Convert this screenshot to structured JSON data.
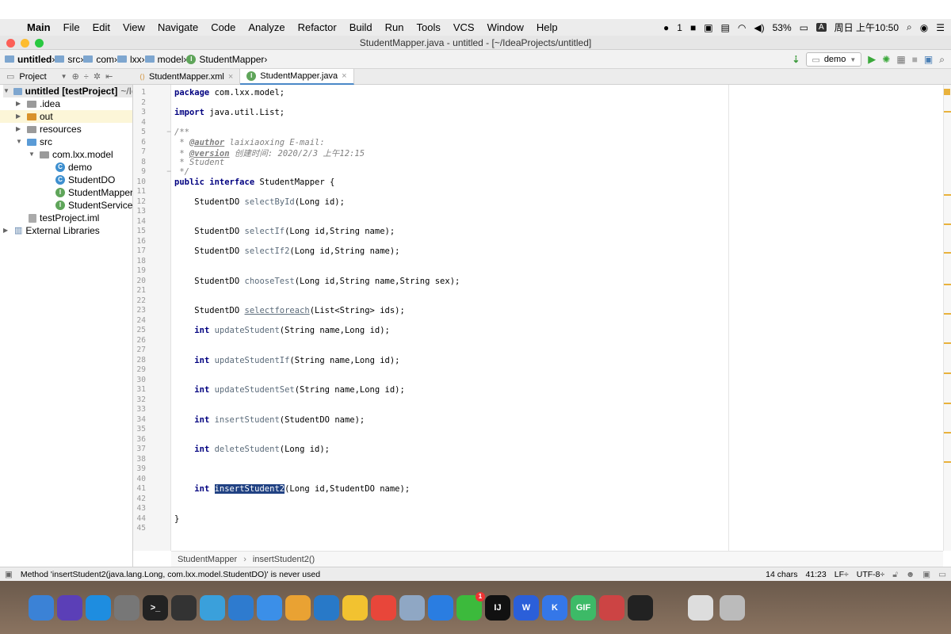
{
  "menubar": {
    "app": "Main",
    "items": [
      "File",
      "Edit",
      "View",
      "Navigate",
      "Code",
      "Analyze",
      "Refactor",
      "Build",
      "Run",
      "Tools",
      "VCS",
      "Window",
      "Help"
    ],
    "wechat_count": "1",
    "battery": "53%",
    "input_method": "A",
    "clock": "周日 上午10:50"
  },
  "window": {
    "title": "StudentMapper.java - untitled - [~/IdeaProjects/untitled]"
  },
  "navbar": {
    "crumbs": [
      "untitled",
      "src",
      "com",
      "lxx",
      "model",
      "StudentMapper"
    ],
    "run_config": "demo"
  },
  "toolwindow": {
    "label": "Project"
  },
  "tabs": [
    {
      "label": "StudentMapper.xml"
    },
    {
      "label": "StudentMapper.java"
    }
  ],
  "tree": [
    {
      "label": "untitled [testProject]",
      "suffix": "~/Ic"
    },
    {
      "label": ".idea"
    },
    {
      "label": "out"
    },
    {
      "label": "resources"
    },
    {
      "label": "src"
    },
    {
      "label": "com.lxx.model"
    },
    {
      "label": "demo"
    },
    {
      "label": "StudentDO"
    },
    {
      "label": "StudentMapper"
    },
    {
      "label": "StudentService"
    },
    {
      "label": "testProject.iml"
    },
    {
      "label": "External Libraries"
    }
  ],
  "code": {
    "line_numbers": [
      "1",
      "2",
      "3",
      "4",
      "5",
      "6",
      "7",
      "8",
      "9",
      "10",
      "11",
      "12",
      "13",
      "14",
      "15",
      "16",
      "17",
      "18",
      "19",
      "20",
      "21",
      "22",
      "23",
      "24",
      "25",
      "26",
      "27",
      "28",
      "29",
      "30",
      "31",
      "32",
      "33",
      "34",
      "35",
      "36",
      "37",
      "38",
      "39",
      "40",
      "41",
      "42",
      "43",
      "44",
      "45"
    ],
    "l1_kw": "package",
    "l1_rest": " com.lxx.model;",
    "l3_kw": "import",
    "l3_rest": " java.util.List;",
    "l5": "/**",
    "l6_pre": " * ",
    "l6_tag": "@author",
    "l6_rest": " laixiaoxing E-mail:",
    "l7_pre": " * ",
    "l7_tag": "@version",
    "l7_rest": " 创建时间: 2020/2/3 上午12:15",
    "l8": " * Student",
    "l9": " */",
    "l10_kw": "public interface",
    "l10_rest": " StudentMapper {",
    "l12_type": "    StudentDO ",
    "l12_name": "selectById",
    "l12_args": "(Long id);",
    "l15_type": "    StudentDO ",
    "l15_name": "selectIf",
    "l15_args": "(Long id,String name);",
    "l17_type": "    StudentDO ",
    "l17_name": "selectIf2",
    "l17_args": "(Long id,String name);",
    "l20_type": "    StudentDO ",
    "l20_name": "chooseTest",
    "l20_args": "(Long id,String name,String sex);",
    "l23_type": "    StudentDO ",
    "l23_name": "selectforeach",
    "l23_args": "(List<String> ids);",
    "l25_kw": "int",
    "l25_name": " updateStudent",
    "l25_args": "(String name,Long id);",
    "l28_kw": "int",
    "l28_name": " updateStudentIf",
    "l28_args": "(String name,Long id);",
    "l31_kw": "int",
    "l31_name": " updateStudentSet",
    "l31_args": "(String name,Long id);",
    "l34_kw": "int",
    "l34_name": " insertStudent",
    "l34_args": "(StudentDO name);",
    "l37_kw": "int",
    "l37_name": " deleteStudent",
    "l37_args": "(Long id);",
    "l41_kw": "int",
    "l41_name": "insertStudent2",
    "l41_args": "(Long id,StudentDO name);",
    "l44": "}"
  },
  "editor_footer": {
    "class": "StudentMapper",
    "method": "insertStudent2()"
  },
  "status": {
    "message": "Method 'insertStudent2(java.lang.Long, com.lxx.model.StudentDO)' is never used",
    "chars": "14 chars",
    "position": "41:23",
    "line_sep": "LF÷",
    "encoding": "UTF-8÷"
  },
  "dock": {
    "wechat_badge": "1",
    "apps": [
      "finder-icon",
      "siri-icon",
      "safari-icon",
      "system-preferences-icon",
      "terminal-icon",
      "activity-monitor-icon",
      "docker-icon",
      "edge-icon",
      "feishu-icon",
      "chrome-canary-icon",
      "vscode-icon",
      "notes-icon",
      "chrome-icon",
      "preview-icon",
      "maps-icon",
      "wechat-icon",
      "intellij-icon",
      "wps-icon",
      "kuaiting-icon",
      "gif-icon",
      "java-icon",
      "quicktime-icon",
      "document-icon",
      "trash-icon"
    ]
  }
}
